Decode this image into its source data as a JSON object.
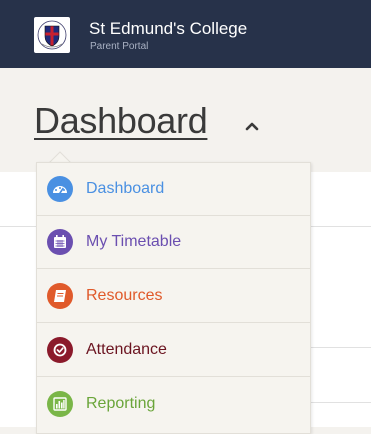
{
  "header": {
    "college_name": "St Edmund's College",
    "portal_subtitle": "Parent Portal",
    "logo_icon": "college-crest-icon",
    "background_color": "#27324a"
  },
  "page": {
    "title": "Dashboard",
    "dropdown_icon": "chevron-up-icon"
  },
  "menu": {
    "items": [
      {
        "label": "Dashboard",
        "icon": "speedometer-icon",
        "color": "#4a90e2"
      },
      {
        "label": "My Timetable",
        "icon": "calendar-icon",
        "color": "#6b4fb0"
      },
      {
        "label": "Resources",
        "icon": "book-icon",
        "color": "#e05a2b"
      },
      {
        "label": "Attendance",
        "icon": "check-circle-icon",
        "color": "#8b1a2b"
      },
      {
        "label": "Reporting",
        "icon": "bar-chart-icon",
        "color": "#7ab648"
      }
    ]
  }
}
